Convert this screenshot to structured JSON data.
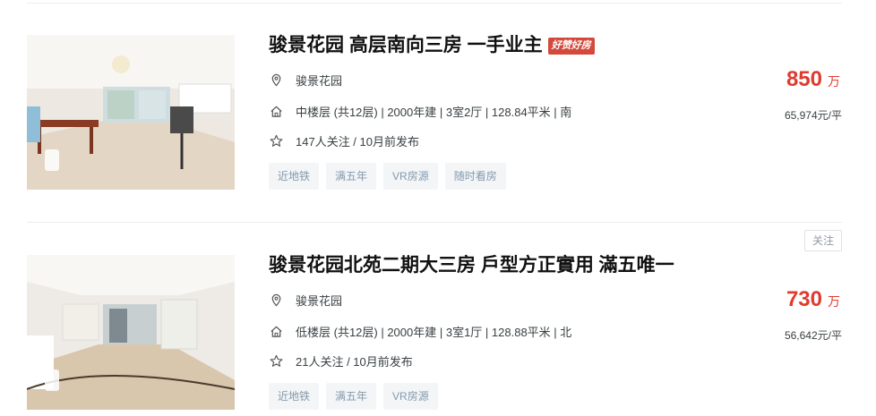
{
  "listings": [
    {
      "title": "骏景花园 高层南向三房 一手业主",
      "badge": "好赞好房",
      "community": "骏景花园",
      "info": "中楼层 (共12层) | 2000年建 | 3室2厅 | 128.84平米 | 南",
      "follow": "147人关注 / 10月前发布",
      "tags": [
        "近地铁",
        "满五年",
        "VR房源",
        "随时看房"
      ],
      "price": "850",
      "price_unit": "万",
      "unit_price": "65,974元/平"
    },
    {
      "title": "骏景花园北苑二期大三房 戶型方正實用 滿五唯一",
      "follow_button": "关注",
      "community": "骏景花园",
      "info": "低楼层 (共12层) | 2000年建 | 3室1厅 | 128.88平米 | 北",
      "follow": "21人关注 / 10月前发布",
      "tags": [
        "近地铁",
        "满五年",
        "VR房源"
      ],
      "price": "730",
      "price_unit": "万",
      "unit_price": "56,642元/平"
    }
  ],
  "icons": {
    "location": "location-pin-icon",
    "house": "house-icon",
    "star": "star-icon",
    "vr": "vr-badge-icon"
  },
  "colors": {
    "price": "#e03b2f",
    "badge": "#d34a3c",
    "tag_text": "#849aae",
    "tag_bg": "#f3f5f7"
  }
}
